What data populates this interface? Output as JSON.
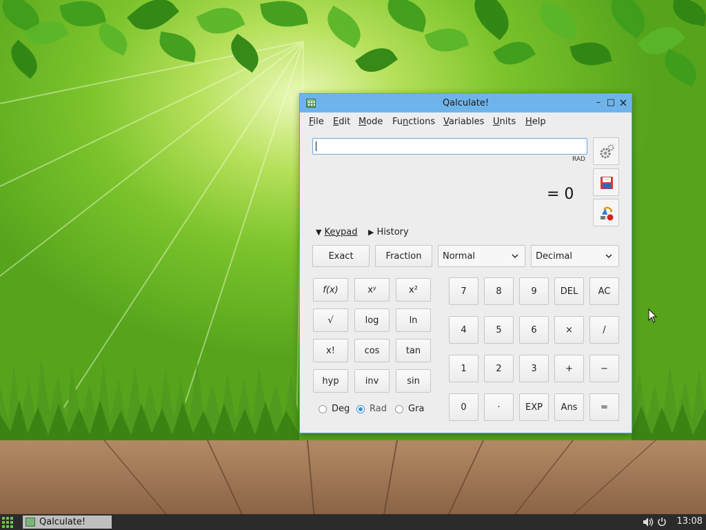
{
  "window": {
    "title": "Qalculate!",
    "controls": {
      "minimize": "–",
      "maximize": "□",
      "close": "×"
    }
  },
  "menu": [
    {
      "label": "File",
      "mnemonic_index": 0
    },
    {
      "label": "Edit",
      "mnemonic_index": 0
    },
    {
      "label": "Mode",
      "mnemonic_index": 0
    },
    {
      "label": "Functions",
      "mnemonic_index": 2
    },
    {
      "label": "Variables",
      "mnemonic_index": 0
    },
    {
      "label": "Units",
      "mnemonic_index": 0
    },
    {
      "label": "Help",
      "mnemonic_index": 0
    }
  ],
  "expression": {
    "value": "",
    "angle_mode": "RAD"
  },
  "result": {
    "text": "= 0"
  },
  "side_buttons": [
    "preferences",
    "save",
    "convert-units"
  ],
  "expanders": {
    "keypad": {
      "label": "Keypad",
      "expanded": true
    },
    "history": {
      "label": "History",
      "expanded": false
    }
  },
  "toolbar": {
    "exact_label": "Exact",
    "fraction_label": "Fraction",
    "format_selected": "Normal",
    "base_selected": "Decimal"
  },
  "functions_keys": [
    [
      "f(x)",
      "xʸ",
      "x²"
    ],
    [
      "√",
      "log",
      "ln"
    ],
    [
      "x!",
      "cos",
      "tan"
    ],
    [
      "hyp",
      "inv",
      "sin"
    ]
  ],
  "number_keys": [
    [
      "7",
      "8",
      "9",
      "DEL",
      "AC"
    ],
    [
      "4",
      "5",
      "6",
      "×",
      "/"
    ],
    [
      "1",
      "2",
      "3",
      "+",
      "−"
    ],
    [
      "0",
      "·",
      "EXP",
      "Ans",
      "="
    ]
  ],
  "angle_units": [
    {
      "label": "Deg",
      "checked": false
    },
    {
      "label": "Rad",
      "checked": true
    },
    {
      "label": "Gra",
      "checked": false
    }
  ],
  "taskbar": {
    "task_label": "Qalculate!",
    "clock": "13:08",
    "tray_icons": [
      "volume-icon",
      "power-icon"
    ]
  },
  "colors": {
    "titlebar": "#6eb4ea",
    "focus_accent": "#3a8fd9",
    "taskbar": "#2b2b2b"
  }
}
